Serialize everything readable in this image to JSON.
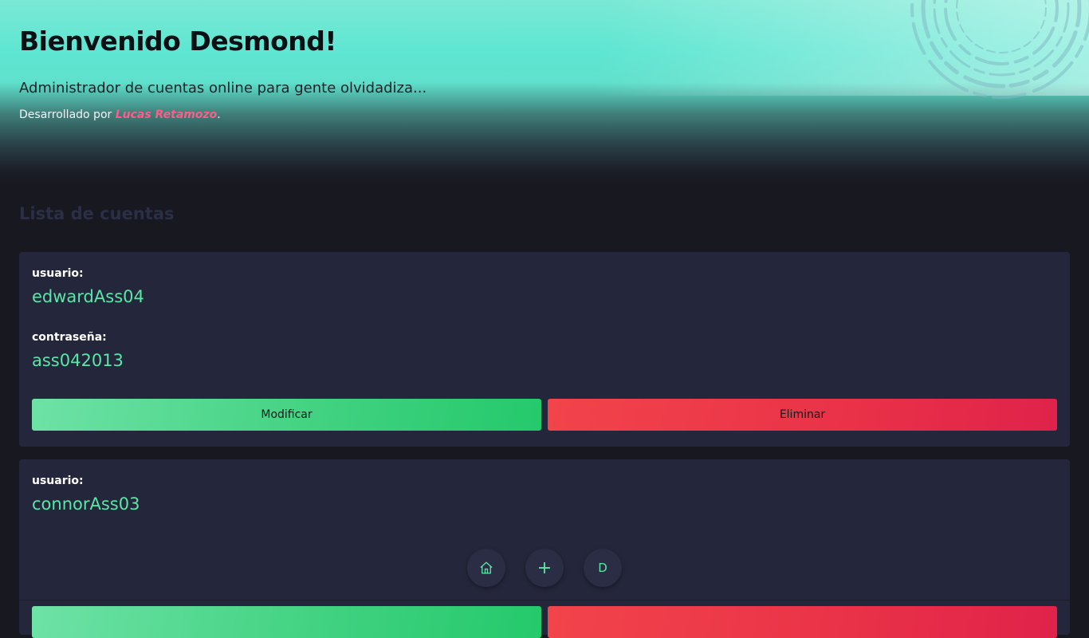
{
  "header": {
    "title": "Bienvenido Desmond!",
    "subtitle": "Administrador de cuentas online para gente olvidadiza...",
    "credit_prefix": "Desarrollado por ",
    "credit_author": "Lucas Retamozo",
    "credit_suffix": "."
  },
  "section": {
    "title": "Lista de cuentas"
  },
  "accounts": [
    {
      "user_label": "usuario:",
      "user_value": "edwardAss04",
      "password_label": "contraseña:",
      "password_value": "ass042013",
      "edit_label": "Modificar",
      "delete_label": "Eliminar"
    },
    {
      "user_label": "usuario:",
      "user_value": "connorAss03",
      "edit_label": "",
      "delete_label": ""
    }
  ],
  "dock": {
    "home_icon": "home-icon",
    "add_icon": "plus-icon",
    "add_glyph": "+",
    "user_initial": "D"
  },
  "colors": {
    "accent": "#5be6a8",
    "edit": "#3fd17f",
    "delete": "#ea3348",
    "author": "#ff5c8a",
    "card_bg": "#24263b",
    "page_bg": "#181821"
  }
}
